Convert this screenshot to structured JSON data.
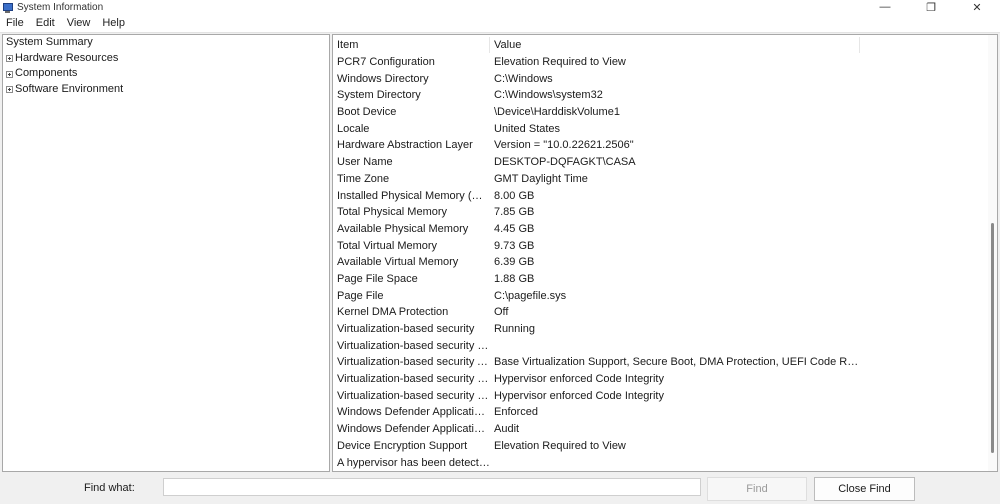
{
  "window": {
    "title": "System Information",
    "app_icon": "system-information-icon",
    "controls": [
      "minimize-icon",
      "restore-icon",
      "close-icon"
    ]
  },
  "menu": [
    "File",
    "Edit",
    "View",
    "Help"
  ],
  "tree": {
    "root": "System Summary",
    "children": [
      "Hardware Resources",
      "Components",
      "Software Environment"
    ]
  },
  "table": {
    "columns": [
      "Item",
      "Value"
    ],
    "rows": [
      {
        "item": "PCR7 Configuration",
        "value": "Elevation Required to View"
      },
      {
        "item": "Windows Directory",
        "value": "C:\\Windows"
      },
      {
        "item": "System Directory",
        "value": "C:\\Windows\\system32"
      },
      {
        "item": "Boot Device",
        "value": "\\Device\\HarddiskVolume1"
      },
      {
        "item": "Locale",
        "value": "United States"
      },
      {
        "item": "Hardware Abstraction Layer",
        "value": "Version = \"10.0.22621.2506\""
      },
      {
        "item": "User Name",
        "value": "DESKTOP-DQFAGKT\\CASA"
      },
      {
        "item": "Time Zone",
        "value": "GMT Daylight Time"
      },
      {
        "item": "Installed Physical Memory (RAM)",
        "value": "8.00 GB"
      },
      {
        "item": "Total Physical Memory",
        "value": "7.85 GB"
      },
      {
        "item": "Available Physical Memory",
        "value": "4.45 GB"
      },
      {
        "item": "Total Virtual Memory",
        "value": "9.73 GB"
      },
      {
        "item": "Available Virtual Memory",
        "value": "6.39 GB"
      },
      {
        "item": "Page File Space",
        "value": "1.88 GB"
      },
      {
        "item": "Page File",
        "value": "C:\\pagefile.sys"
      },
      {
        "item": "Kernel DMA Protection",
        "value": "Off"
      },
      {
        "item": "Virtualization-based security",
        "value": "Running"
      },
      {
        "item": "Virtualization-based security Re...",
        "value": ""
      },
      {
        "item": "Virtualization-based security Av...",
        "value": "Base Virtualization Support, Secure Boot, DMA Protection, UEFI Code Readonly..."
      },
      {
        "item": "Virtualization-based security Se...",
        "value": "Hypervisor enforced Code Integrity"
      },
      {
        "item": "Virtualization-based security Se...",
        "value": "Hypervisor enforced Code Integrity"
      },
      {
        "item": "Windows Defender Application ...",
        "value": "Enforced"
      },
      {
        "item": "Windows Defender Application ...",
        "value": "Audit"
      },
      {
        "item": "Device Encryption Support",
        "value": "Elevation Required to View"
      },
      {
        "item": "A hypervisor has been detected....",
        "value": ""
      }
    ]
  },
  "find": {
    "label": "Find what:",
    "value": "",
    "find_button": "Find",
    "close_button": "Close Find"
  }
}
